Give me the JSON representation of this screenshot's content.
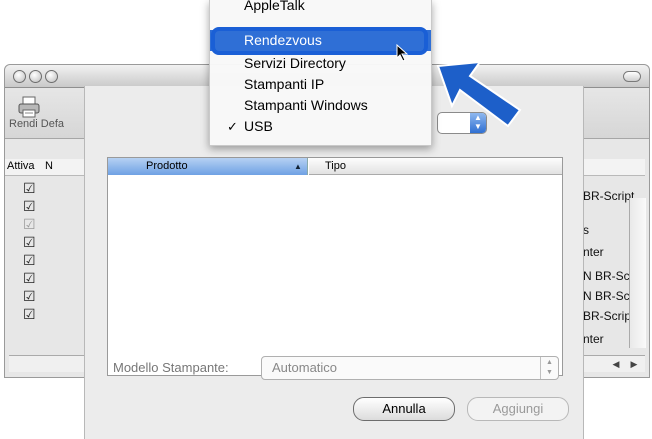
{
  "menu": {
    "items": [
      {
        "label": "AppleTalk",
        "selected": false,
        "checked": false
      },
      {
        "label": "Rendezvous",
        "selected": true,
        "checked": false
      },
      {
        "label": "Servizi Directory",
        "selected": false,
        "checked": false
      },
      {
        "label": "Stampanti IP",
        "selected": false,
        "checked": false
      },
      {
        "label": "Stampanti Windows",
        "selected": false,
        "checked": false
      },
      {
        "label": "USB",
        "selected": false,
        "checked": true
      }
    ],
    "checkmark": "✓"
  },
  "window": {
    "toolbar_label": "Rendi Defa",
    "columns": {
      "attiva": "Attiva",
      "n": "N"
    },
    "checks": [
      "☑",
      "☑",
      "☑",
      "☑",
      "☑",
      "☑",
      "☑",
      "☑"
    ],
    "right_texts": [
      "BR-Script",
      "s",
      "nter",
      "N BR-Scri",
      "N BR-Scri",
      "BR-Script",
      "nter"
    ]
  },
  "sheet": {
    "table_headers": {
      "product": "Prodotto",
      "type": "Tipo"
    },
    "model_label": "Modello Stampante:",
    "model_value": "Automatico",
    "cancel_button": "Annulla",
    "add_button": "Aggiungi"
  },
  "colors": {
    "selection": "#2f6fd6",
    "highlight": "#1a5fd6",
    "arrow": "#1d5fc9"
  },
  "icons": [
    "printer-icon",
    "checkmark-icon",
    "sort-arrow-icon",
    "mouse-cursor-icon",
    "pointer-arrow-icon"
  ]
}
